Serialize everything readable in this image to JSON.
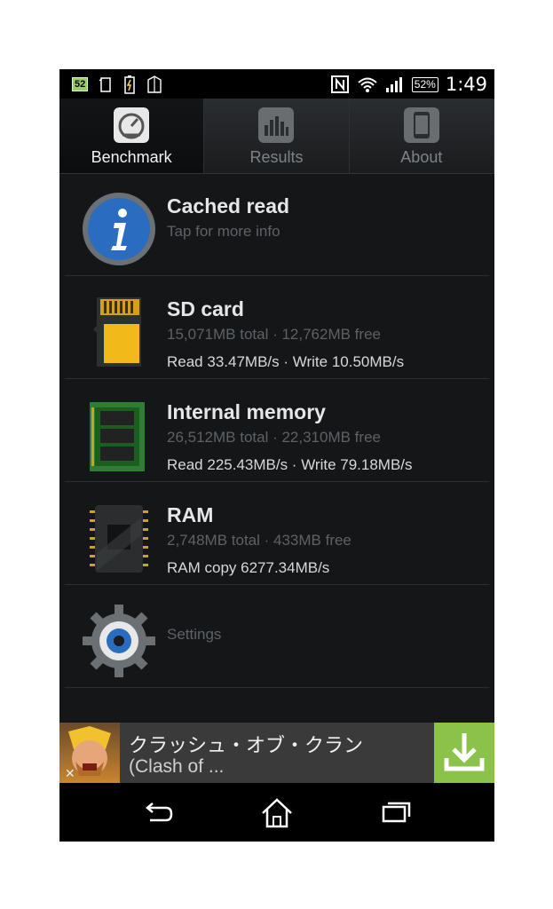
{
  "status_bar": {
    "notification_badge": "52",
    "battery": "52%",
    "time": "1:49"
  },
  "tabs": [
    {
      "label": "Benchmark",
      "icon": "speedometer-icon",
      "active": true
    },
    {
      "label": "Results",
      "icon": "bar-chart-icon",
      "active": false
    },
    {
      "label": "About",
      "icon": "phone-icon",
      "active": false
    }
  ],
  "items": [
    {
      "title": "Cached read",
      "subtitle": "Tap for more info",
      "speed": "",
      "icon": "info-icon"
    },
    {
      "title": "SD card",
      "subtitle": "15,071MB total · 12,762MB free",
      "speed": "Read 33.47MB/s · Write 10.50MB/s",
      "icon": "sd-card-icon"
    },
    {
      "title": "Internal memory",
      "subtitle": "26,512MB total · 22,310MB free",
      "speed": "Read 225.43MB/s · Write 79.18MB/s",
      "icon": "memory-chip-icon"
    },
    {
      "title": "RAM",
      "subtitle": "2,748MB total · 433MB free",
      "speed": "RAM copy 6277.34MB/s",
      "icon": "ram-chip-icon"
    },
    {
      "title": "",
      "subtitle": "Settings",
      "speed": "",
      "icon": "gear-icon"
    }
  ],
  "ad": {
    "title": "クラッシュ・オブ・クラン",
    "subtitle": "(Clash of ...",
    "close": "✕"
  },
  "colors": {
    "background": "#141618",
    "accent_ad_download": "#8bc34a"
  }
}
